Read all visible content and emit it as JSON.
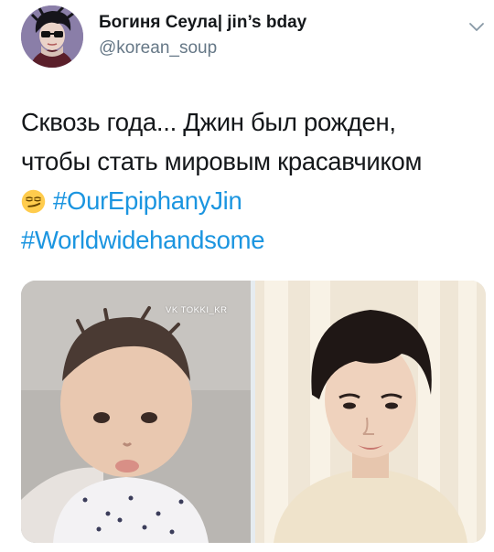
{
  "tweet": {
    "display_name": "Богиня Сеула| jin’s bday",
    "handle": "@korean_soup",
    "text_line1": "Сквозь года... Джин был рожден,",
    "text_line2": "чтобы стать мировым красавчиком",
    "emoji": "smirking-face-emoji",
    "hashtag1": "#OurEpiphanyJin",
    "hashtag2": "#Worldwidehandsome",
    "menu_icon": "chevron-down-icon"
  },
  "media": {
    "watermark": "VK TOKKI_KR",
    "left_photo": "baby photo",
    "right_photo": "adult portrait photo"
  },
  "colors": {
    "text": "#14171a",
    "secondary": "#657786",
    "link": "#1b95e0",
    "background": "#ffffff"
  }
}
